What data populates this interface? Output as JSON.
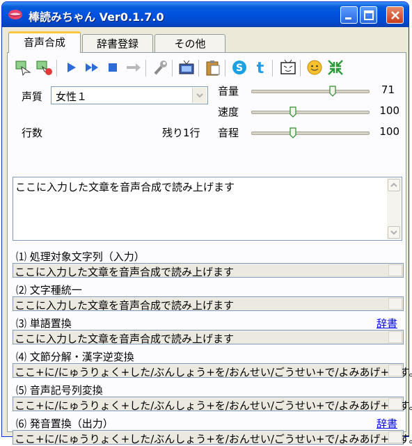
{
  "window": {
    "title": "棒読みちゃん Ver0.1.7.0"
  },
  "tabs": [
    {
      "label": "音声合成",
      "active": true
    },
    {
      "label": "辞書登録",
      "active": false
    },
    {
      "label": "その他",
      "active": false
    }
  ],
  "toolbar": {
    "icons": [
      "read-clipboard-icon",
      "stop-clipboard-icon",
      "play-icon",
      "fast-forward-icon",
      "stop-icon",
      "next-icon",
      "wrench-icon",
      "tv-icon",
      "clipboard-icon",
      "skype-icon",
      "twitter-icon",
      "niconico-icon",
      "smiley-icon",
      "shrink-icon"
    ]
  },
  "voice": {
    "label": "声質",
    "selected": "女性１"
  },
  "lines": {
    "label": "行数",
    "remaining": "残り1行"
  },
  "sliders": [
    {
      "label": "音量",
      "value": "71",
      "level_pct": 71
    },
    {
      "label": "速度",
      "value": "100",
      "level_pct": 35
    },
    {
      "label": "音程",
      "value": "100",
      "level_pct": 35
    }
  ],
  "input": {
    "text": "ここに入力した文章を音声合成で読み上げます"
  },
  "stages": [
    {
      "label": "⑴ 処理対象文字列（入力）",
      "value": "ここに入力した文章を音声合成で読み上げます",
      "link": ""
    },
    {
      "label": "⑵ 文字種統一",
      "value": "ここに入力した文章を音声合成で読み上げます",
      "link": ""
    },
    {
      "label": "⑶ 単語置換",
      "value": "ここに入力した文章を音声合成で読み上げます",
      "link": "辞書"
    },
    {
      "label": "⑷ 文節分解・漢字逆変換",
      "value": "ここ+に/にゅうりょく+した/ぶんしょう+を/おんせい/ごうせい+で/よみあげ+ます。",
      "link": ""
    },
    {
      "label": "⑸ 音声記号列変換",
      "value": "ここ+に/にゅうりょく+した/ぶんしょう+を/おんせい/ごうせい+で/よみあげ+ます。",
      "link": ""
    },
    {
      "label": "⑹ 発音置換（出力）",
      "value": "ここ+に/にゅうりょく+した/ぶんしょう+を/おんせい/ごうせい+で/よみあげ+ます。",
      "link": "辞書"
    }
  ],
  "colors": {
    "titlebar": "#0053e1",
    "tab_highlight": "#ffc83c",
    "link": "#0000ee",
    "panel_bg": "#fcfcfe"
  }
}
